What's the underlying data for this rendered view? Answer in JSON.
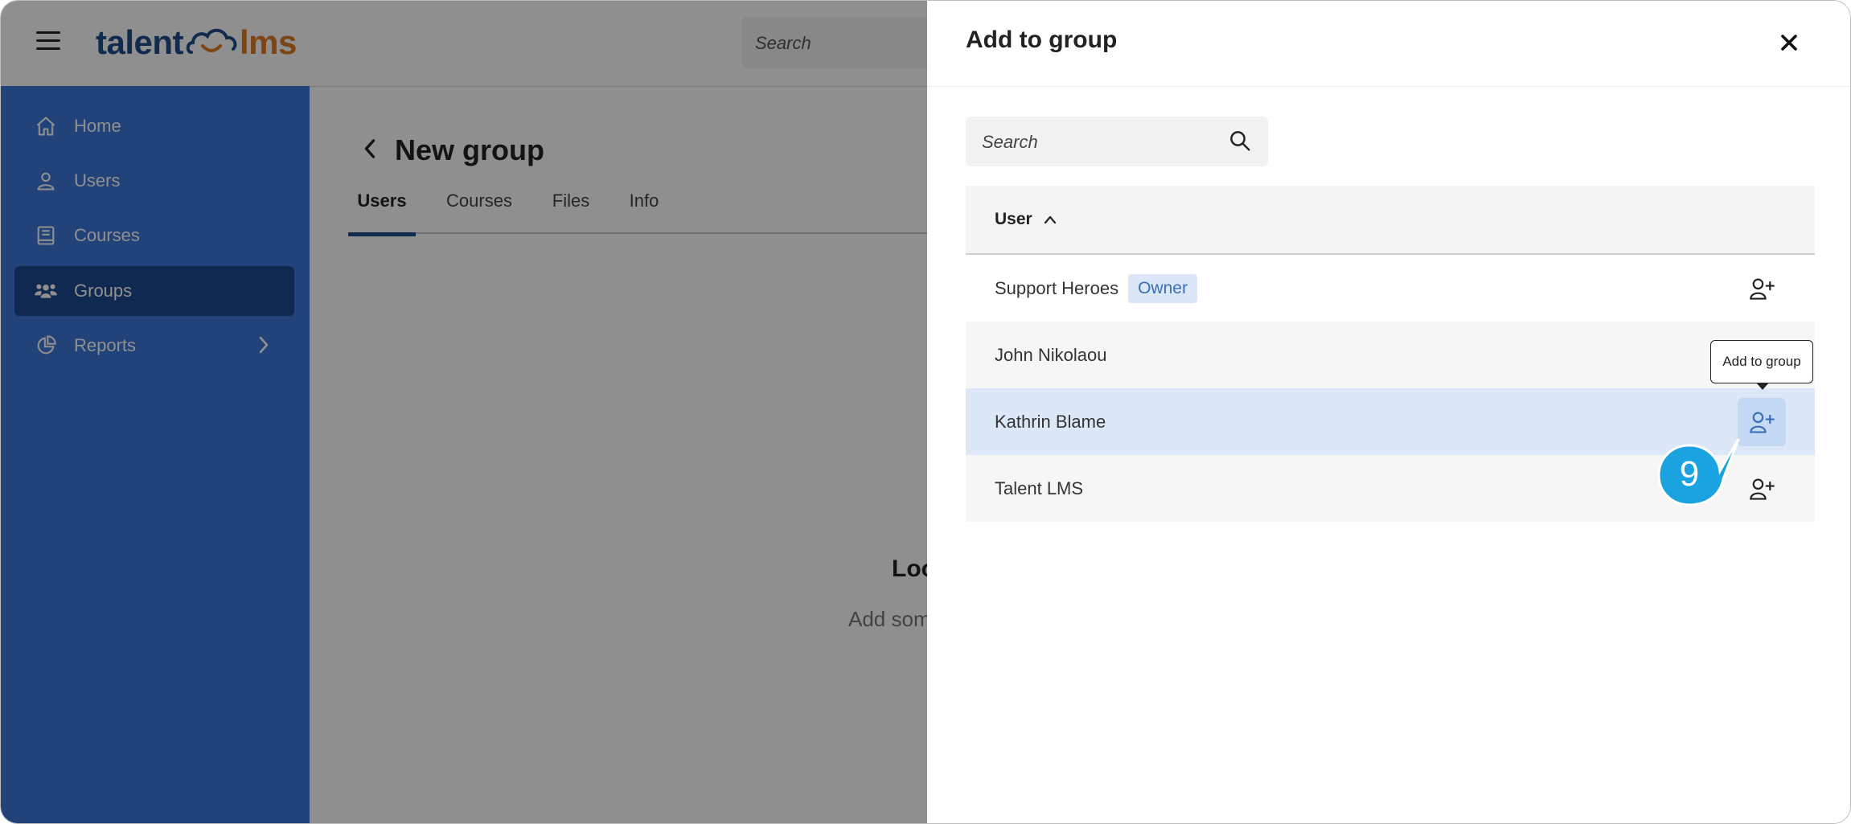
{
  "app": {
    "logo_left": "talent",
    "logo_right": "lms",
    "search_placeholder": "Search"
  },
  "sidebar": {
    "items": [
      {
        "label": "Home",
        "icon": "home-icon"
      },
      {
        "label": "Users",
        "icon": "user-icon"
      },
      {
        "label": "Courses",
        "icon": "book-icon"
      },
      {
        "label": "Groups",
        "icon": "group-icon"
      },
      {
        "label": "Reports",
        "icon": "pie-chart-icon"
      }
    ]
  },
  "main": {
    "title": "New group",
    "tabs": [
      "Users",
      "Courses",
      "Files",
      "Info"
    ],
    "empty_title": "Loo",
    "empty_subtitle": "Add som"
  },
  "drawer": {
    "title": "Add to group",
    "search_placeholder": "Search",
    "column_header": "User",
    "rows": [
      {
        "name": "Support Heroes",
        "badge": "Owner"
      },
      {
        "name": "John Nikolaou"
      },
      {
        "name": "Kathrin Blame"
      },
      {
        "name": "Talent LMS"
      }
    ],
    "tooltip": "Add to group"
  },
  "step_marker": "9",
  "colors": {
    "sidebar": "#3c78d8",
    "sidebar_active": "#1e4a8f",
    "brand_blue": "#1f4e8c",
    "brand_orange": "#e07b24",
    "step_marker": "#1aa3e0",
    "row_highlight": "#dce8f8"
  }
}
